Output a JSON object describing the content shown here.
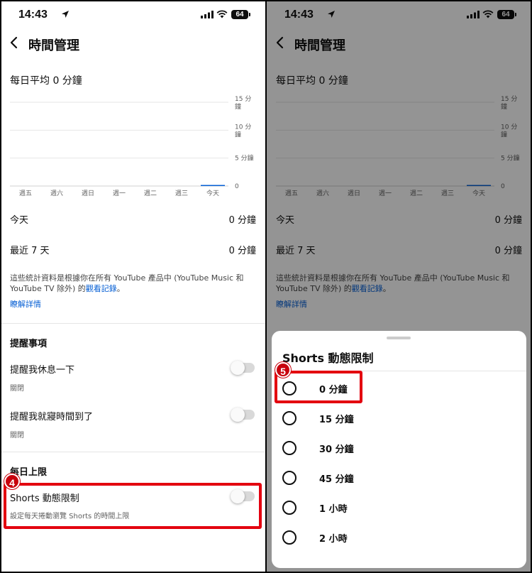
{
  "status": {
    "time": "14:43",
    "battery": "64"
  },
  "header": {
    "title": "時間管理",
    "back_icon": "chevron-left-icon"
  },
  "stats": {
    "daily_average": "每日平均 0 分鐘",
    "today_label": "今天",
    "today_value": "0 分鐘",
    "last7_label": "最近 7 天",
    "last7_value": "0 分鐘",
    "description_part1": "這些統計資料是根據你在所有 YouTube 產品中 (YouTube Music 和 YouTube TV 除外) 的",
    "description_link": "觀看記錄",
    "description_end": "。",
    "learn_more": "瞭解詳情"
  },
  "chart_data": {
    "type": "bar",
    "categories": [
      "週五",
      "週六",
      "週日",
      "週一",
      "週二",
      "週三",
      "今天"
    ],
    "values": [
      0,
      0,
      0,
      0,
      0,
      0,
      0
    ],
    "y_ticks": [
      {
        "value": 15,
        "label": [
          "15 分",
          "鐘"
        ]
      },
      {
        "value": 10,
        "label": [
          "10 分",
          "鐘"
        ]
      },
      {
        "value": 5,
        "label": [
          "5 分鐘"
        ]
      },
      {
        "value": 0,
        "label": [
          "0"
        ]
      }
    ],
    "ylim": [
      0,
      15
    ],
    "grid": true,
    "highlight_color": "#065fd4"
  },
  "reminders": {
    "title": "提醒事項",
    "break_label": "提醒我休息一下",
    "break_status": "關閉",
    "bedtime_label": "提醒我就寢時間到了",
    "bedtime_status": "關閉"
  },
  "daily_limit": {
    "title": "每日上限",
    "shorts_label": "Shorts 動態限制",
    "shorts_desc": "設定每天捲動瀏覽 Shorts 的時間上限",
    "step_number": "4"
  },
  "sheet": {
    "title": "Shorts 動態限制",
    "step_number": "5",
    "options": [
      "0 分鐘",
      "15 分鐘",
      "30 分鐘",
      "45 分鐘",
      "1 小時",
      "2 小時"
    ]
  },
  "colors": {
    "accent": "#e3000f",
    "link": "#065fd4"
  }
}
